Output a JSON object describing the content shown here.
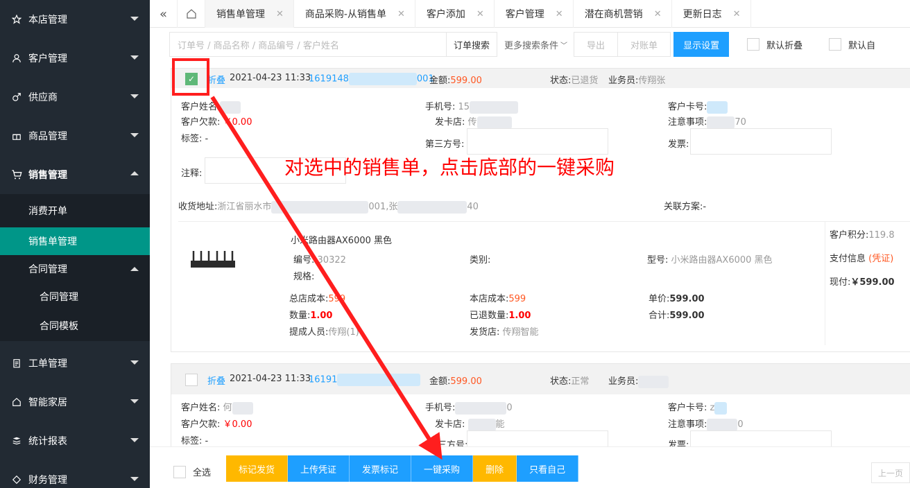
{
  "sidebar": {
    "items": [
      {
        "label": "本店管理",
        "icon": "star-icon"
      },
      {
        "label": "客户管理",
        "icon": "user-icon"
      },
      {
        "label": "供应商",
        "icon": "male-icon"
      },
      {
        "label": "商品管理",
        "icon": "gift-icon"
      },
      {
        "label": "销售管理",
        "icon": "cart-icon"
      },
      {
        "label": "工单管理",
        "icon": "clipboard-icon"
      },
      {
        "label": "智能家居",
        "icon": "home-icon"
      },
      {
        "label": "统计报表",
        "icon": "report-icon"
      },
      {
        "label": "财务管理",
        "icon": "finance-icon"
      }
    ],
    "sales_sub": [
      {
        "label": "消费开单"
      },
      {
        "label": "销售单管理"
      },
      {
        "label": "合同管理"
      }
    ],
    "contract_sub": [
      {
        "label": "合同管理"
      },
      {
        "label": "合同模板"
      }
    ]
  },
  "tabs": [
    {
      "label": "销售单管理"
    },
    {
      "label": "商品采购-从销售单"
    },
    {
      "label": "客户添加"
    },
    {
      "label": "客户管理"
    },
    {
      "label": "潜在商机营销"
    },
    {
      "label": "更新日志"
    }
  ],
  "tab_close": "✕",
  "toolbar": {
    "search_placeholder": "订单号 / 商品名称 / 商品编号 / 客户姓名",
    "search_btn": "订单搜索",
    "more_conditions": "更多搜索条件",
    "export": "导出",
    "reconcile": "对账单",
    "display_settings": "显示设置",
    "default_fold": "默认折叠",
    "default_self": "默认自"
  },
  "order1": {
    "fold": "折叠",
    "datetime": "2021-04-23 11:33",
    "order_no_start": "1619148",
    "order_no_end": "001",
    "amount_label": "金额:",
    "amount": "599.00",
    "status_label": "状态:",
    "status": "已退货",
    "clerk_label": "业务员:",
    "clerk": "传翔张",
    "customer_name_label": "客户姓名:",
    "phone_label": "手机号:",
    "phone_partial": "15",
    "card_label": "客户卡号:",
    "debt_label": "客户欠款:",
    "debt": "￥0.00",
    "store_label": "发卡店:",
    "store_partial": "传",
    "notes_label": "注意事项:",
    "notes_partial": "70",
    "tag_label": "标签:",
    "tag": "-",
    "third_party_label": "第三方号:",
    "invoice_label": "发票:",
    "remark_label": "注释:",
    "address_label": "收货地址:",
    "address_partial1": "浙江省丽水市",
    "address_partial2": "001,张",
    "address_partial3": "40",
    "scheme_label": "关联方案:",
    "scheme": "-",
    "product_name": "小米路由器AX6000 黑色",
    "code_label": "编号:",
    "code": "30322",
    "category_label": "类别:",
    "model_label": "型号:",
    "model": "小米路由器AX6000 黑色",
    "spec_label": "规格:",
    "hq_cost_label": "总店成本:",
    "hq_cost": "599",
    "store_cost_label": "本店成本:",
    "store_cost": "599",
    "unit_price_label": "单价:",
    "unit_price": "599.00",
    "qty_label": "数量:",
    "qty": "1.00",
    "returned_label": "已退数量:",
    "returned": "1.00",
    "total_label": "合计:",
    "total": "599.00",
    "commission_label": "提成人员:",
    "commission": "传翔",
    "commission_count": "(1)",
    "ship_store_label": "发货店:",
    "ship_store": "传翔智能",
    "points_label": "客户积分:",
    "points": "119.8",
    "payment_label": "支付信息",
    "voucher": "(凭证)",
    "cash_label": "现付:",
    "cash": "￥599.00"
  },
  "order2": {
    "fold": "折叠",
    "datetime": "2021-04-23 11:33",
    "order_no_start": "16191",
    "amount_label": "金额:",
    "amount": "599.00",
    "status_label": "状态:",
    "status": "正常",
    "clerk_label": "业务员:",
    "customer_name_label": "客户姓名:",
    "customer_partial": "何",
    "phone_label": "手机号:",
    "phone_partial": "0",
    "card_label": "客户卡号:",
    "card_partial": "z",
    "debt_label": "客户欠款:",
    "debt": "￥0.00",
    "store_label": "发卡店:",
    "store_partial": "能",
    "notes_label": "注意事项:",
    "notes_partial": "0",
    "tag_label": "标签:",
    "tag": "-",
    "third_party_label": "三方号:",
    "invoice_label": "发票:"
  },
  "bottom": {
    "select_all": "全选",
    "actions": [
      {
        "label": "标记发货",
        "color": "#ffb800"
      },
      {
        "label": "上传凭证",
        "color": "#1e9fff"
      },
      {
        "label": "发票标记",
        "color": "#1e9fff"
      },
      {
        "label": "一键采购",
        "color": "#1e9fff"
      },
      {
        "label": "删除",
        "color": "#ffb800"
      },
      {
        "label": "只看自己",
        "color": "#1e9fff"
      }
    ],
    "prev_page": "上一页"
  },
  "annotation": {
    "text": "对选中的销售单，点击底部的一键采购",
    "color": "#ff0000"
  }
}
